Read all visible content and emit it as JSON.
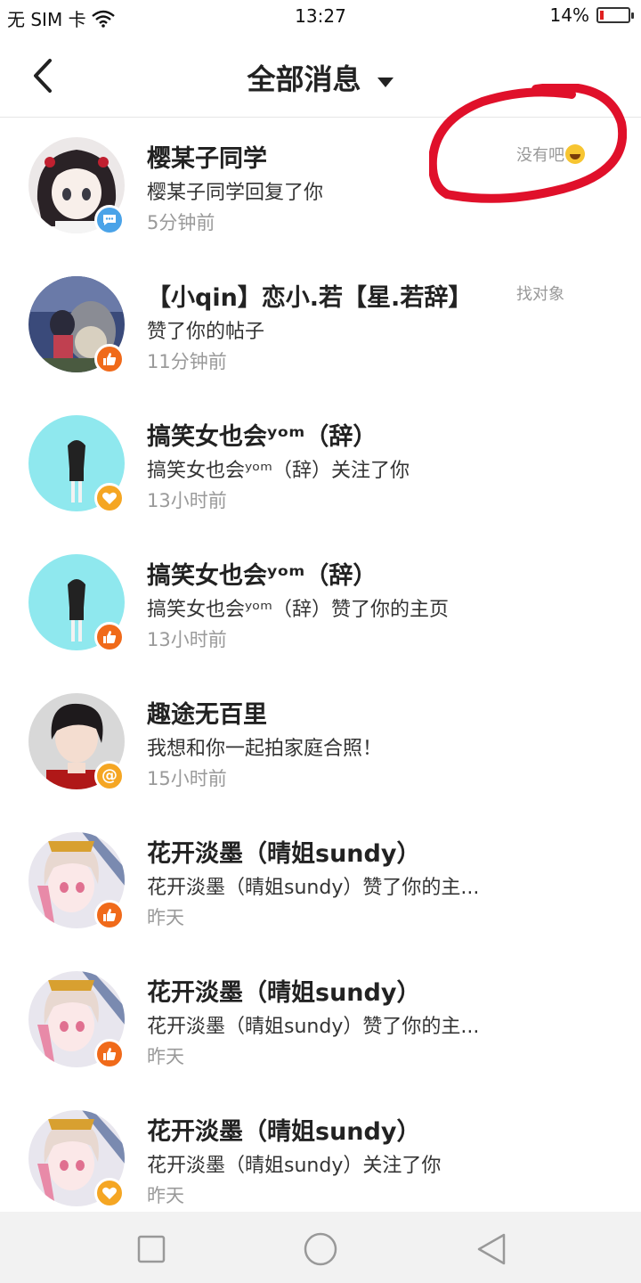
{
  "status_bar": {
    "carrier": "无 SIM 卡",
    "time": "13:27",
    "battery_percent": "14%",
    "battery_level": 0.14
  },
  "header": {
    "title": "全部消息"
  },
  "colors": {
    "badge_comment": "#4aa3e8",
    "badge_like": "#f06a1a",
    "badge_follow": "#f5a623",
    "badge_mention": "#f5a623",
    "annotation_red": "#e0102a"
  },
  "messages": [
    {
      "name": "樱某子同学",
      "text": "樱某子同学回复了你",
      "time": "5分钟前",
      "quote": "没有吧",
      "badge": "comment-icon"
    },
    {
      "name": "【小qin】恋小.若【星.若辞】",
      "text": "赞了你的帖子",
      "time": "11分钟前",
      "quote": "找对象",
      "badge": "thumbs-up-icon"
    },
    {
      "name": "搞笑女也会ʸᵒᵐ（辞）",
      "text": "搞笑女也会ʸᵒᵐ（辞）关注了你",
      "time": "13小时前",
      "badge": "heart-icon"
    },
    {
      "name": "搞笑女也会ʸᵒᵐ（辞）",
      "text": "搞笑女也会ʸᵒᵐ（辞）赞了你的主页",
      "time": "13小时前",
      "badge": "thumbs-up-icon"
    },
    {
      "name": "趣途无百里",
      "text": "我想和你一起拍家庭合照！",
      "time": "15小时前",
      "badge": "at-icon"
    },
    {
      "name": "花开淡墨（晴姐sundy）",
      "text": "花开淡墨（晴姐sundy）赞了你的主...",
      "time": "昨天",
      "badge": "thumbs-up-icon"
    },
    {
      "name": "花开淡墨（晴姐sundy）",
      "text": "花开淡墨（晴姐sundy）赞了你的主...",
      "time": "昨天",
      "badge": "thumbs-up-icon"
    },
    {
      "name": "花开淡墨（晴姐sundy）",
      "text": "花开淡墨（晴姐sundy）关注了你",
      "time": "昨天",
      "badge": "heart-icon"
    }
  ]
}
